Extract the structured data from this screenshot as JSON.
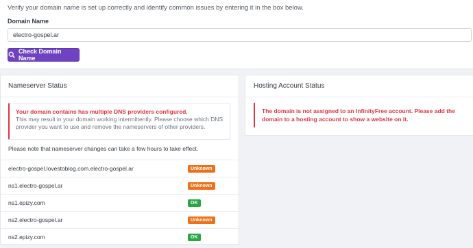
{
  "intro_text": "Verify your domain name is set up correctly and identify common issues by entering it in the box below.",
  "domain_form": {
    "label": "Domain Name",
    "value": "electro-gospel.ar",
    "button_label": "Check Domain Name",
    "button_icon": "search-icon",
    "accent_color": "#6f42c1"
  },
  "nameserver_status": {
    "title": "Nameserver Status",
    "alert": {
      "title": "Your domain contains has multiple DNS providers configured.",
      "body": "This may result in your domain working intermittently. Please choose which DNS provider you want to use and remove the nameservers of other providers."
    },
    "note": "Please note that nameserver changes can take a few hours to take effect.",
    "nameservers": [
      {
        "name": "electro-gospel.lovestoblog.com.electro-gospel.ar",
        "status": "Unknown"
      },
      {
        "name": "ns1.electro-gospel.ar",
        "status": "Unknown"
      },
      {
        "name": "ns1.epizy.com",
        "status": "OK"
      },
      {
        "name": "ns2.electro-gospel.ar",
        "status": "Unknown"
      },
      {
        "name": "ns2.epizy.com",
        "status": "OK"
      }
    ],
    "status_colors": {
      "Unknown": "#f0701a",
      "OK": "#28a745"
    }
  },
  "hosting_status": {
    "title": "Hosting Account Status",
    "alert": "The domain is not assigned to an InfinityFree account. Please add the domain to a hosting account to show a website on it."
  }
}
